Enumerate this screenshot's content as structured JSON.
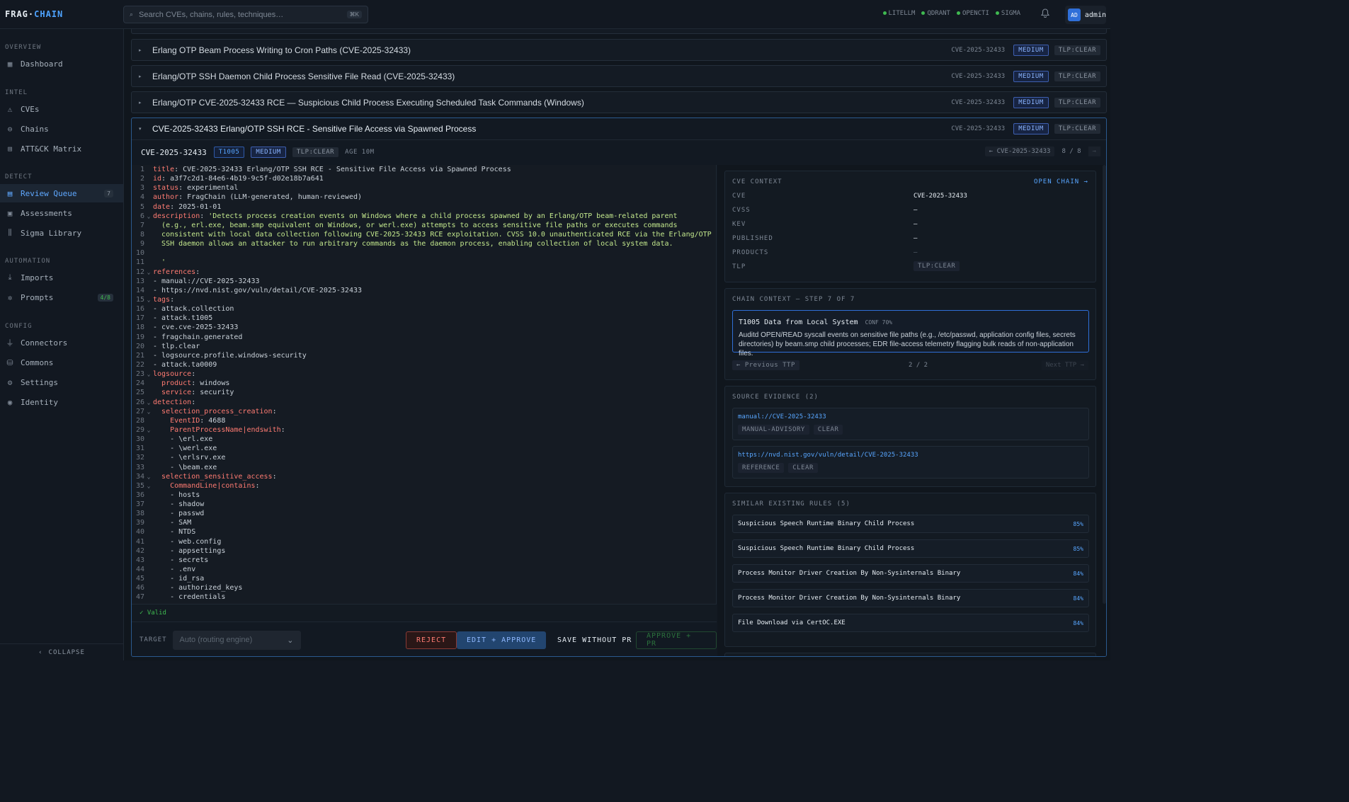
{
  "app": {
    "logo_a": "FRAG·",
    "logo_b": "CHAIN"
  },
  "search": {
    "placeholder": "Search CVEs, chains, rules, techniques…",
    "shortcut": "⌘K"
  },
  "status": [
    "LITELLM",
    "QDRANT",
    "OPENCTI",
    "SIGMA"
  ],
  "user": {
    "initials": "AD",
    "name": "admin"
  },
  "sidebar": {
    "sections": [
      "OVERVIEW",
      "INTEL",
      "DETECT",
      "AUTOMATION",
      "CONFIG"
    ],
    "items": [
      {
        "label": "Dashboard",
        "icon": "grid-icon"
      },
      {
        "label": "CVEs",
        "icon": "warning-icon"
      },
      {
        "label": "Chains",
        "icon": "link-icon"
      },
      {
        "label": "ATT&CK Matrix",
        "icon": "matrix-icon"
      },
      {
        "label": "Review Queue",
        "icon": "document-icon",
        "count": "7"
      },
      {
        "label": "Assessments",
        "icon": "clipboard-icon"
      },
      {
        "label": "Sigma Library",
        "icon": "library-icon"
      },
      {
        "label": "Imports",
        "icon": "download-icon"
      },
      {
        "label": "Prompts",
        "icon": "sparkle-icon",
        "count": "4/8"
      },
      {
        "label": "Connectors",
        "icon": "plug-icon"
      },
      {
        "label": "Commons",
        "icon": "database-icon"
      },
      {
        "label": "Settings",
        "icon": "gear-icon"
      },
      {
        "label": "Identity",
        "icon": "user-circle-icon"
      }
    ],
    "collapse": "COLLAPSE"
  },
  "rows": [
    {
      "title": "Erlang OTP Beam Process Writing to Cron Paths (CVE-2025-32433)",
      "cve": "CVE-2025-32433",
      "severity": "MEDIUM",
      "tlp": "TLP:CLEAR"
    },
    {
      "title": "Erlang/OTP SSH Daemon Child Process Sensitive File Read (CVE-2025-32433)",
      "cve": "CVE-2025-32433",
      "severity": "MEDIUM",
      "tlp": "TLP:CLEAR"
    },
    {
      "title": "Erlang/OTP CVE-2025-32433 RCE — Suspicious Child Process Executing Scheduled Task Commands (Windows)",
      "cve": "CVE-2025-32433",
      "severity": "MEDIUM",
      "tlp": "TLP:CLEAR"
    }
  ],
  "expanded": {
    "title": "CVE-2025-32433 Erlang/OTP SSH RCE - Sensitive File Access via Spawned Process",
    "cve": "CVE-2025-32433",
    "severity": "MEDIUM",
    "tlp": "TLP:CLEAR",
    "technique": "T1005",
    "age": "AGE 10M",
    "pager": {
      "prev": "← CVE-2025-32433",
      "pos": "8 / 8",
      "next": "→"
    },
    "valid": "✓ Valid",
    "target_label": "TARGET",
    "target_placeholder": "Auto (routing engine)",
    "buttons": {
      "reject": "REJECT",
      "edit": "EDIT + APPROVE",
      "save": "SAVE WITHOUT PR",
      "approve": "APPROVE + PR"
    }
  },
  "code_lines": [
    {
      "n": "1",
      "f": "",
      "k": "title",
      "v": ": CVE-2025-32433 Erlang/OTP SSH RCE - Sensitive File Access via Spawned Process",
      "i": ""
    },
    {
      "n": "2",
      "f": "",
      "k": "id",
      "v": ": a3f7c2d1-84e6-4b19-9c5f-d02e18b7a641",
      "i": ""
    },
    {
      "n": "3",
      "f": "",
      "k": "status",
      "v": ": experimental",
      "i": ""
    },
    {
      "n": "4",
      "f": "",
      "k": "author",
      "v": ": FragChain (LLM-generated, human-reviewed)",
      "i": ""
    },
    {
      "n": "5",
      "f": "",
      "k": "date",
      "v": ": 2025-01-01",
      "i": ""
    },
    {
      "n": "6",
      "f": "⌄",
      "k": "description",
      "v": ": ",
      "s": "'Detects process creation events on Windows where a child process spawned by an Erlang/OTP beam-related parent",
      "i": ""
    },
    {
      "n": "7",
      "f": "",
      "k": "",
      "v": "",
      "s": "(e.g., erl.exe, beam.smp equivalent on Windows, or werl.exe) attempts to access sensitive file paths or executes commands",
      "i": "  "
    },
    {
      "n": "8",
      "f": "",
      "k": "",
      "v": "",
      "s": "consistent with local data collection following CVE-2025-32433 RCE exploitation. CVSS 10.0 unauthenticated RCE via the Erlang/OTP",
      "i": "  "
    },
    {
      "n": "9",
      "f": "",
      "k": "",
      "v": "",
      "s": "SSH daemon allows an attacker to run arbitrary commands as the daemon process, enabling collection of local system data.",
      "i": "  "
    },
    {
      "n": "10",
      "f": "",
      "k": "",
      "v": "",
      "i": ""
    },
    {
      "n": "11",
      "f": "",
      "k": "",
      "v": "",
      "s": "'",
      "i": "  "
    },
    {
      "n": "12",
      "f": "⌄",
      "k": "references",
      "v": ":",
      "i": ""
    },
    {
      "n": "13",
      "f": "",
      "k": "",
      "v": "- manual://CVE-2025-32433",
      "i": ""
    },
    {
      "n": "14",
      "f": "",
      "k": "",
      "v": "- https://nvd.nist.gov/vuln/detail/CVE-2025-32433",
      "i": ""
    },
    {
      "n": "15",
      "f": "⌄",
      "k": "tags",
      "v": ":",
      "i": ""
    },
    {
      "n": "16",
      "f": "",
      "k": "",
      "v": "- attack.collection",
      "i": ""
    },
    {
      "n": "17",
      "f": "",
      "k": "",
      "v": "- attack.t1005",
      "i": ""
    },
    {
      "n": "18",
      "f": "",
      "k": "",
      "v": "- cve.cve-2025-32433",
      "i": ""
    },
    {
      "n": "19",
      "f": "",
      "k": "",
      "v": "- fragchain.generated",
      "i": ""
    },
    {
      "n": "20",
      "f": "",
      "k": "",
      "v": "- tlp.clear",
      "i": ""
    },
    {
      "n": "21",
      "f": "",
      "k": "",
      "v": "- logsource.profile.windows-security",
      "i": ""
    },
    {
      "n": "22",
      "f": "",
      "k": "",
      "v": "- attack.ta0009",
      "i": ""
    },
    {
      "n": "23",
      "f": "⌄",
      "k": "logsource",
      "v": ":",
      "i": ""
    },
    {
      "n": "24",
      "f": "",
      "k": "product",
      "v": ": windows",
      "i": "  "
    },
    {
      "n": "25",
      "f": "",
      "k": "service",
      "v": ": security",
      "i": "  "
    },
    {
      "n": "26",
      "f": "⌄",
      "k": "detection",
      "v": ":",
      "i": ""
    },
    {
      "n": "27",
      "f": "⌄",
      "k": "selection_process_creation",
      "v": ":",
      "i": "  "
    },
    {
      "n": "28",
      "f": "",
      "k": "EventID",
      "v": ": 4688",
      "i": "    "
    },
    {
      "n": "29",
      "f": "⌄",
      "k": "ParentProcessName|endswith",
      "v": ":",
      "i": "    "
    },
    {
      "n": "30",
      "f": "",
      "k": "",
      "v": "- \\erl.exe",
      "i": "    "
    },
    {
      "n": "31",
      "f": "",
      "k": "",
      "v": "- \\werl.exe",
      "i": "    "
    },
    {
      "n": "32",
      "f": "",
      "k": "",
      "v": "- \\erlsrv.exe",
      "i": "    "
    },
    {
      "n": "33",
      "f": "",
      "k": "",
      "v": "- \\beam.exe",
      "i": "    "
    },
    {
      "n": "34",
      "f": "⌄",
      "k": "selection_sensitive_access",
      "v": ":",
      "i": "  "
    },
    {
      "n": "35",
      "f": "⌄",
      "k": "CommandLine|contains",
      "v": ":",
      "i": "    "
    },
    {
      "n": "36",
      "f": "",
      "k": "",
      "v": "- hosts",
      "i": "    "
    },
    {
      "n": "37",
      "f": "",
      "k": "",
      "v": "- shadow",
      "i": "    "
    },
    {
      "n": "38",
      "f": "",
      "k": "",
      "v": "- passwd",
      "i": "    "
    },
    {
      "n": "39",
      "f": "",
      "k": "",
      "v": "- SAM",
      "i": "    "
    },
    {
      "n": "40",
      "f": "",
      "k": "",
      "v": "- NTDS",
      "i": "    "
    },
    {
      "n": "41",
      "f": "",
      "k": "",
      "v": "- web.config",
      "i": "    "
    },
    {
      "n": "42",
      "f": "",
      "k": "",
      "v": "- appsettings",
      "i": "    "
    },
    {
      "n": "43",
      "f": "",
      "k": "",
      "v": "- secrets",
      "i": "    "
    },
    {
      "n": "44",
      "f": "",
      "k": "",
      "v": "- .env",
      "i": "    "
    },
    {
      "n": "45",
      "f": "",
      "k": "",
      "v": "- id_rsa",
      "i": "    "
    },
    {
      "n": "46",
      "f": "",
      "k": "",
      "v": "- authorized_keys",
      "i": "    "
    },
    {
      "n": "47",
      "f": "",
      "k": "",
      "v": "- credentials",
      "i": "    "
    }
  ],
  "cve_context": {
    "heading": "CVE CONTEXT",
    "open_chain": "OPEN CHAIN →",
    "fields": [
      {
        "k": "CVE",
        "v": "CVE-2025-32433"
      },
      {
        "k": "CVSS",
        "v": "—"
      },
      {
        "k": "KEV",
        "v": "—"
      },
      {
        "k": "PUBLISHED",
        "v": "—"
      },
      {
        "k": "PRODUCTS",
        "v": "—"
      },
      {
        "k": "TLP",
        "v": "TLP:CLEAR"
      }
    ]
  },
  "chain_context": {
    "heading": "CHAIN CONTEXT — STEP 7 OF 7",
    "ttp_title": "T1005 Data from Local System",
    "conf": "CONF 70%",
    "ttp_desc": "Auditd OPEN/READ syscall events on sensitive file paths (e.g., /etc/passwd, application config files, secrets directories) by beam.smp child processes; EDR file-access telemetry flagging bulk reads of non-application files.",
    "prev": "← Previous TTP",
    "pos": "2 / 2",
    "next": "Next TTP →"
  },
  "evidence": {
    "heading": "SOURCE EVIDENCE (2)",
    "items": [
      {
        "url": "manual://CVE-2025-32433",
        "tag1": "MANUAL-ADVISORY",
        "tag2": "CLEAR"
      },
      {
        "url": "https://nvd.nist.gov/vuln/detail/CVE-2025-32433",
        "tag1": "REFERENCE",
        "tag2": "CLEAR"
      }
    ]
  },
  "similar": {
    "heading": "SIMILAR EXISTING RULES (5)",
    "items": [
      {
        "name": "Suspicious Speech Runtime Binary Child Process",
        "pct": "85%"
      },
      {
        "name": "Suspicious Speech Runtime Binary Child Process",
        "pct": "85%"
      },
      {
        "name": "Process Monitor Driver Creation By Non-Sysinternals Binary",
        "pct": "84%"
      },
      {
        "name": "Process Monitor Driver Creation By Non-Sysinternals Binary",
        "pct": "84%"
      },
      {
        "name": "File Download via CertOC.EXE",
        "pct": "84%"
      }
    ]
  },
  "colors": {
    "accent": "#58a6ff",
    "active_bg": "#1c2633",
    "valid": "#3fb950",
    "reject": "#ff7b72"
  }
}
